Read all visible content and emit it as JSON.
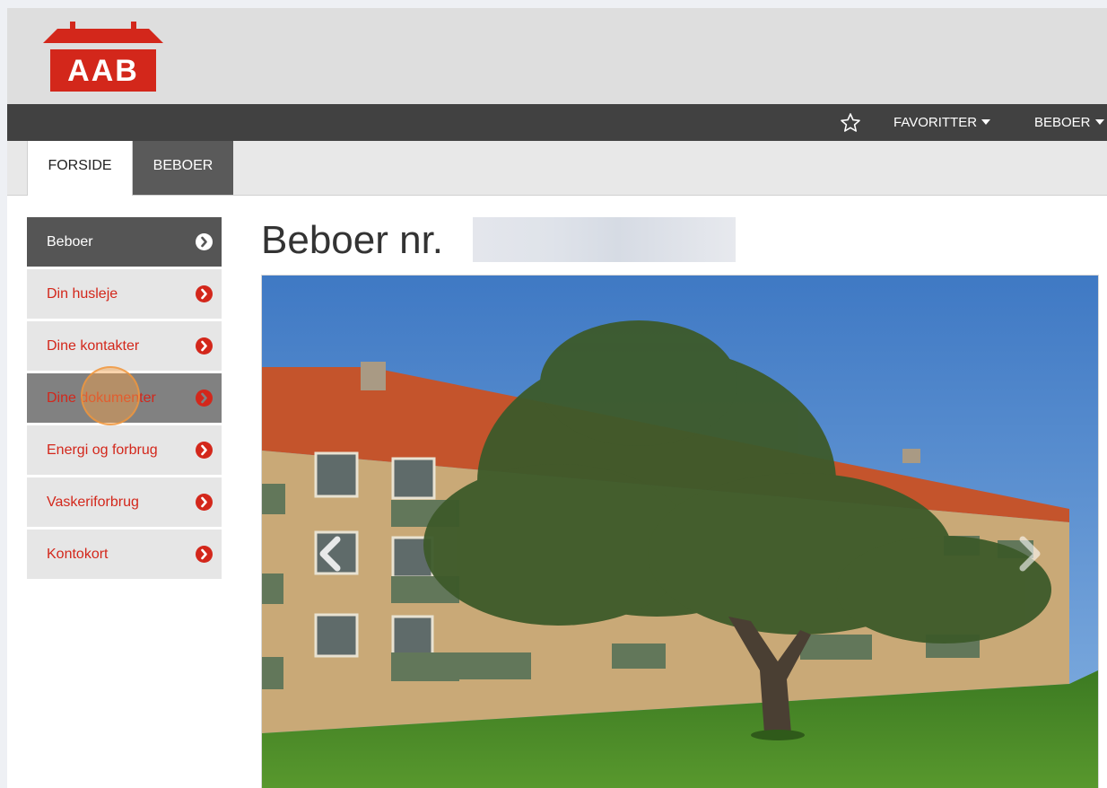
{
  "header": {
    "logo_text": "AAB"
  },
  "topbar": {
    "favorites_label": "FAVORITTER",
    "resident_label": "BEBOER"
  },
  "tabs": [
    {
      "label": "FORSIDE"
    },
    {
      "label": "BEBOER"
    }
  ],
  "sidebar": {
    "items": [
      {
        "label": "Beboer"
      },
      {
        "label": "Din husleje"
      },
      {
        "label": "Dine kontakter"
      },
      {
        "label": "Dine dokumenter"
      },
      {
        "label": "Energi og forbrug"
      },
      {
        "label": "Vaskeriforbrug"
      },
      {
        "label": "Kontokort"
      }
    ]
  },
  "main": {
    "title": "Beboer nr."
  },
  "colors": {
    "accent_red": "#d3271b",
    "topbar": "#414141",
    "header_bg": "#dedede"
  },
  "icons": {
    "favorites": "star-outline-icon",
    "sidebar_arrow": "chevron-circle-right-icon",
    "carousel_prev": "chevron-left-icon",
    "carousel_next": "chevron-right-icon"
  }
}
